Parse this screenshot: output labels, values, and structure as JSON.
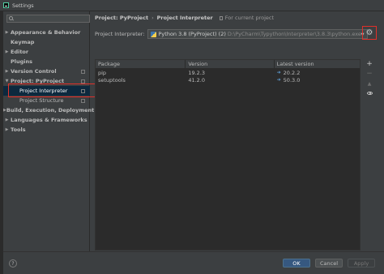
{
  "window": {
    "title": "Settings"
  },
  "sidebar": {
    "search_placeholder": "",
    "items": [
      {
        "label": "Appearance & Behavior",
        "arrow": "▶"
      },
      {
        "label": "Keymap",
        "arrow": ""
      },
      {
        "label": "Editor",
        "arrow": "▶"
      },
      {
        "label": "Plugins",
        "arrow": ""
      },
      {
        "label": "Version Control",
        "arrow": "▶"
      },
      {
        "label": "Project: PyProject",
        "arrow": "▼"
      },
      {
        "label": "Project Interpreter",
        "arrow": ""
      },
      {
        "label": "Project Structure",
        "arrow": ""
      },
      {
        "label": "Build, Execution, Deployment",
        "arrow": "▶"
      },
      {
        "label": "Languages & Frameworks",
        "arrow": "▶"
      },
      {
        "label": "Tools",
        "arrow": "▶"
      }
    ]
  },
  "breadcrumb": {
    "parent": "Project: PyProject",
    "separator": "›",
    "current": "Project Interpreter",
    "note": "For current project"
  },
  "interpreter": {
    "label": "Project Interpreter:",
    "name": "Python 3.8 (PyProject) (2)",
    "path": "D:\\PyCharm\\Typython\\Interpreter\\3.8.3\\python.exe"
  },
  "table": {
    "headers": [
      "Package",
      "Version",
      "Latest version"
    ],
    "rows": [
      {
        "package": "pip",
        "version": "19.2.3",
        "latest": "20.2.2"
      },
      {
        "package": "setuptools",
        "version": "41.2.0",
        "latest": "50.3.0"
      }
    ]
  },
  "tools": {
    "add": "+",
    "remove": "−",
    "upgrade": "▲"
  },
  "footer": {
    "help": "?",
    "ok": "OK",
    "cancel": "Cancel",
    "apply": "Apply"
  },
  "colors": {
    "accent": "#365880",
    "highlight_outline": "#e0302a",
    "selection": "#0d293e",
    "upgrade_arrow": "#5e9ed6"
  }
}
